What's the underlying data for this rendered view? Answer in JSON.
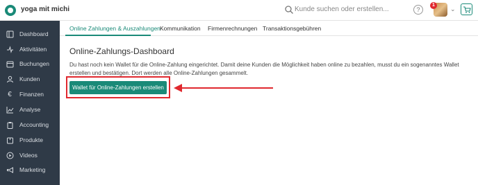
{
  "header": {
    "workspace_name": "yoga mit michi",
    "search_placeholder": "Kunde suchen oder erstellen...",
    "help_label": "?",
    "notification_count": "1",
    "accent_color": "#1a8a78"
  },
  "sidebar": {
    "background": "#2f3a47",
    "items": [
      {
        "label": "Dashboard",
        "icon": "home-icon"
      },
      {
        "label": "Aktivitäten",
        "icon": "activity-icon"
      },
      {
        "label": "Buchungen",
        "icon": "calendar-icon"
      },
      {
        "label": "Kunden",
        "icon": "user-icon"
      },
      {
        "label": "Finanzen",
        "icon": "euro-icon"
      },
      {
        "label": "Analyse",
        "icon": "chart-icon"
      },
      {
        "label": "Accounting",
        "icon": "clipboard-icon"
      },
      {
        "label": "Produkte",
        "icon": "box-icon"
      },
      {
        "label": "Videos",
        "icon": "play-icon"
      },
      {
        "label": "Marketing",
        "icon": "megaphone-icon"
      }
    ]
  },
  "tabs": [
    {
      "label": "Online Zahlungen & Auszahlungen",
      "active": true
    },
    {
      "label": "Kommunikation",
      "active": false
    },
    {
      "label": "Firmenrechnungen",
      "active": false
    },
    {
      "label": "Transaktionsgebühren",
      "active": false
    }
  ],
  "main": {
    "title": "Online-Zahlungs-Dashboard",
    "description": "Du hast noch kein Wallet für die Online-Zahlung eingerichtet. Damit deine Kunden die Möglichkeit haben online zu bezahlen, musst du ein sogenanntes Wallet erstellen und bestätigen. Dort werden alle Online-Zahlungen gesammelt.",
    "cta_label": "Wallet für Online-Zahlungen erstellen",
    "annotation_color": "#e0282e"
  }
}
